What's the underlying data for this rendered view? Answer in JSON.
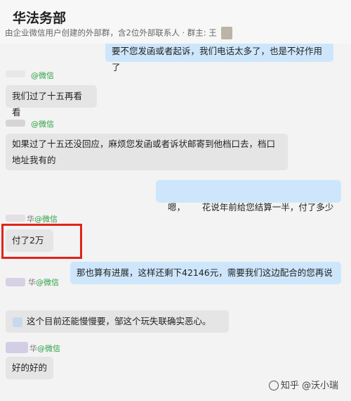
{
  "header": {
    "title": "华法务部",
    "subtitle": "由企业微信用户创建的外部群，含2位外部联系人 · 群主: 王"
  },
  "messages": [
    {
      "dir": "out",
      "text": "要不您发函或者起诉，我们电话太多了，也是不好作用了"
    },
    {
      "sender": "",
      "source": "@微信",
      "dir": "in",
      "text": "我们过了十五再看看"
    },
    {
      "sender": "",
      "source": "@微信",
      "dir": "in",
      "text": "如果过了十五还没回应，麻烦您发函或者诉状邮寄到他档口去，档口地址我有的"
    },
    {
      "dir": "out",
      "text": "嗯，      花说年前给您结算一半，付了多少"
    },
    {
      "sender": "华",
      "source": "@微信",
      "dir": "in",
      "text": "付了2万"
    },
    {
      "dir": "out",
      "text": "那也算有进展，这样还剩下42146元，需要我们这边配合的您再说"
    },
    {
      "sender": "华",
      "source": "@微信",
      "dir": "in",
      "text": "这个目前还能慢慢要，邹这个玩失联确实恶心。"
    },
    {
      "sender": "华",
      "source": "@微信",
      "dir": "in",
      "text": "好的好的"
    }
  ],
  "watermark": "知乎 @沃小瑞",
  "colors": {
    "highlight": "#e0241a",
    "wechat": "#2ba245",
    "out_bubble": "#cde6fb",
    "in_bubble": "#e5e5e5"
  }
}
